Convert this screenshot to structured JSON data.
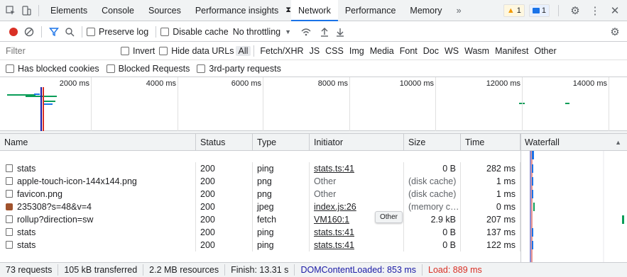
{
  "tabs": {
    "items": [
      "Elements",
      "Console",
      "Sources",
      "Performance insights",
      "Network",
      "Performance",
      "Memory"
    ],
    "active": "Network",
    "more": "»",
    "warnings_count": "1",
    "messages_count": "1"
  },
  "toolbar": {
    "preserve_log": "Preserve log",
    "disable_cache": "Disable cache",
    "throttling": "No throttling"
  },
  "filter": {
    "placeholder": "Filter",
    "invert": "Invert",
    "hide_data_urls": "Hide data URLs",
    "types": [
      "All",
      "Fetch/XHR",
      "JS",
      "CSS",
      "Img",
      "Media",
      "Font",
      "Doc",
      "WS",
      "Wasm",
      "Manifest",
      "Other"
    ],
    "active_type": "All",
    "blocked_cookies": "Has blocked cookies",
    "blocked_requests": "Blocked Requests",
    "third_party": "3rd-party requests"
  },
  "overview": {
    "ticks": [
      "2000 ms",
      "4000 ms",
      "6000 ms",
      "8000 ms",
      "10000 ms",
      "12000 ms",
      "14000 ms"
    ]
  },
  "table": {
    "columns": [
      "Name",
      "Status",
      "Type",
      "Initiator",
      "Size",
      "Time",
      "Waterfall"
    ],
    "rows": [
      {
        "name": "stats",
        "status": "200",
        "type": "ping",
        "initiator": "stats.ts:41",
        "initiator_link": true,
        "size": "0 B",
        "time": "282 ms",
        "icon": "doc"
      },
      {
        "name": "apple-touch-icon-144x144.png",
        "status": "200",
        "type": "png",
        "initiator": "Other",
        "initiator_link": false,
        "size": "(disk cache)",
        "time": "1 ms",
        "icon": "doc"
      },
      {
        "name": "favicon.png",
        "status": "200",
        "type": "png",
        "initiator": "Other",
        "initiator_link": false,
        "size": "(disk cache)",
        "time": "1 ms",
        "icon": "doc"
      },
      {
        "name": "235308?s=48&v=4",
        "status": "200",
        "type": "jpeg",
        "initiator": "index.js:26",
        "initiator_link": true,
        "size": "(memory c…",
        "time": "0 ms",
        "icon": "avatar"
      },
      {
        "name": "rollup?direction=sw",
        "status": "200",
        "type": "fetch",
        "initiator": "VM160:1",
        "initiator_link": true,
        "size": "2.9 kB",
        "time": "207 ms",
        "icon": "doc"
      },
      {
        "name": "stats",
        "status": "200",
        "type": "ping",
        "initiator": "stats.ts:41",
        "initiator_link": true,
        "size": "0 B",
        "time": "137 ms",
        "icon": "doc"
      },
      {
        "name": "stats",
        "status": "200",
        "type": "ping",
        "initiator": "stats.ts:41",
        "initiator_link": true,
        "size": "0 B",
        "time": "122 ms",
        "icon": "doc"
      }
    ]
  },
  "tooltip": "Other",
  "status": {
    "requests": "73 requests",
    "transferred": "105 kB transferred",
    "resources": "2.2 MB resources",
    "finish": "Finish: 13.31 s",
    "dom_loaded": "DOMContentLoaded: 853 ms",
    "load": "Load: 889 ms"
  },
  "colors": {
    "accent": "#1a73e8",
    "dom_loaded": "#1a1aa6",
    "load": "#d93025",
    "waterfall_bar": "#1a73e8",
    "warning_badge": "#fef7e0",
    "message_badge": "#e8f0fe"
  }
}
